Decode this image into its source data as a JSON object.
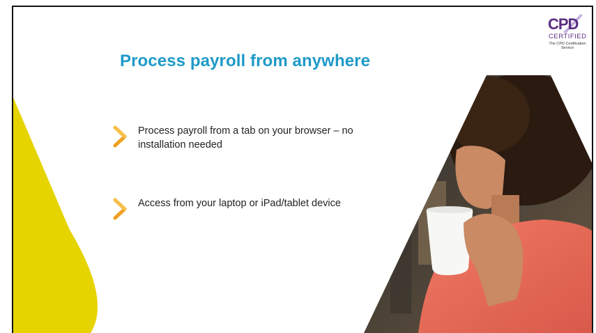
{
  "slide": {
    "title": "Process payroll from anywhere",
    "bullets": [
      {
        "text": "Process payroll from a tab on your browser – no installation needed",
        "icon": "chevron-right-icon"
      },
      {
        "text": "Access from your laptop or iPad/tablet device",
        "icon": "chevron-right-icon"
      }
    ]
  },
  "badge": {
    "logo_text": "CPD",
    "sub_text": "CERTIFIED",
    "service_text": "The CPD Certification Service"
  },
  "colors": {
    "title": "#1e9ac8",
    "accent_yellow": "#e6d400",
    "chevron_orange": "#f0a020",
    "badge_purple": "#5a2d82"
  }
}
